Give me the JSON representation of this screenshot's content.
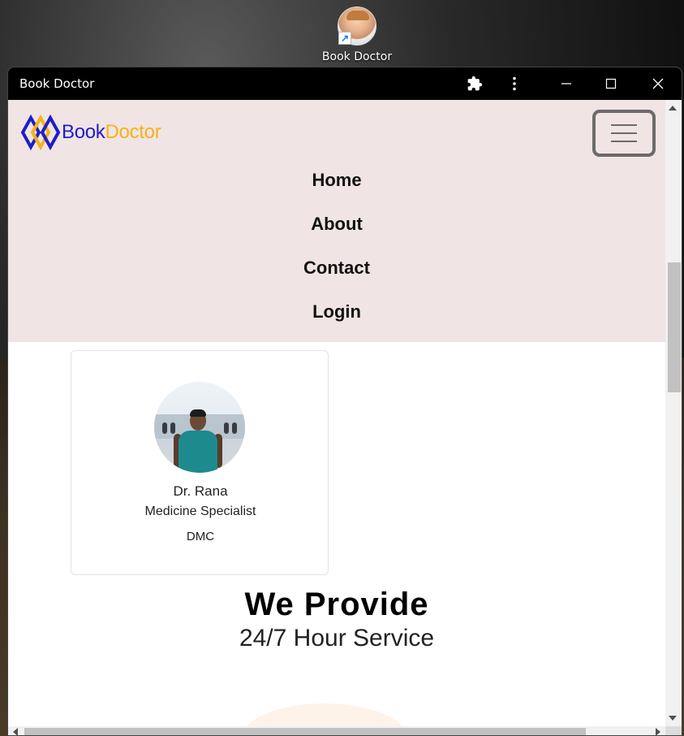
{
  "desktop": {
    "shortcut_label": "Book Doctor"
  },
  "window": {
    "title": "Book Doctor",
    "icons": {
      "extensions": "puzzle-icon",
      "more": "kebab-menu-icon",
      "minimize": "minimize-icon",
      "maximize": "maximize-icon",
      "close": "close-icon"
    }
  },
  "navbar": {
    "brand_part1": "Book",
    "brand_part2": "Doctor",
    "brand_colors": {
      "book": "#1e1ec8",
      "doctor": "#f5b21a"
    },
    "background": "#f0e4e4",
    "toggler_icon": "hamburger-icon",
    "links": [
      {
        "label": "Home"
      },
      {
        "label": "About"
      },
      {
        "label": "Contact"
      },
      {
        "label": "Login"
      }
    ]
  },
  "doctor_card": {
    "name": "Dr. Rana",
    "specialty": "Medicine Specialist",
    "organization": "DMC"
  },
  "provide_section": {
    "heading": "We Provide",
    "subheading": "24/7 Hour Service"
  }
}
